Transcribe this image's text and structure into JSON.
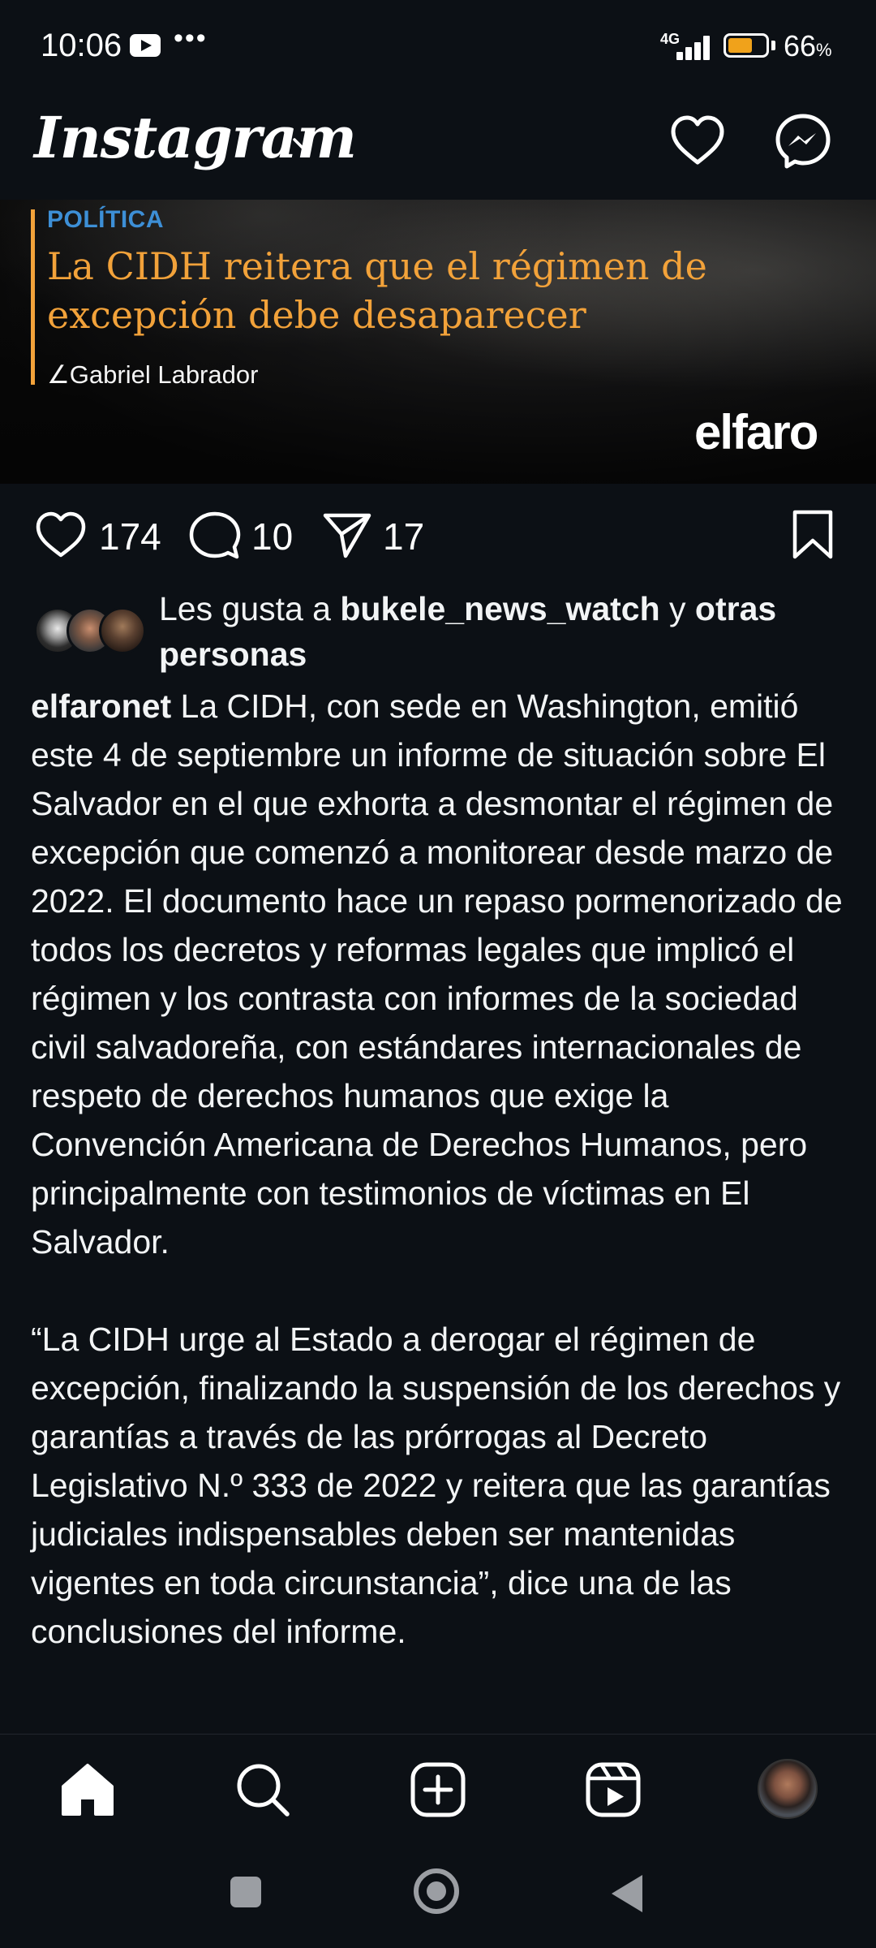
{
  "status_bar": {
    "time": "10:06",
    "overflow_dots": "•••",
    "network": "4G",
    "battery_percent": "66",
    "battery_unit": "%",
    "battery_level": 0.66
  },
  "header": {
    "logo": "Instagram"
  },
  "post_image": {
    "category": "POLÍTICA",
    "headline": "La CIDH reitera que el régimen de excepción debe desaparecer",
    "author": "∠Gabriel Labrador",
    "brand": "elfaro"
  },
  "actions": {
    "likes": "174",
    "comments": "10",
    "shares": "17"
  },
  "likes_summary": {
    "prefix": "Les gusta a ",
    "user": "bukele_news_watch",
    "connector": " y ",
    "others": "otras personas"
  },
  "caption": {
    "username": "elfaronet",
    "paragraph1": " La CIDH, con sede en Washington, emitió este 4 de septiembre un informe de situación sobre El Salvador en el que exhorta a desmontar el régimen de excepción que comenzó a monitorear desde marzo de 2022. El documento hace un repaso pormenorizado de todos los decretos y reformas legales que implicó el régimen y los contrasta con informes de la sociedad civil salvadoreña, con estándares internacionales de respeto de derechos humanos que exige la Convención Americana de Derechos Humanos, pero principalmente con testimonios de víctimas en El Salvador.",
    "paragraph2": "“La CIDH urge al Estado a derogar el régimen de excepción, finalizando la suspensión de los derechos y garantías a través de las prórrogas al Decreto Legislativo N.º 333 de 2022 y reitera que las garantías judiciales indispensables deben ser mantenidas vigentes en toda circunstancia”, dice una de las conclusiones del informe."
  },
  "colors": {
    "background": "#0c1015",
    "headline_orange": "#f2a23a",
    "category_blue": "#3d8fd6",
    "battery_fill": "#f0a21b"
  },
  "icons": [
    "youtube-icon",
    "signal-icon",
    "battery-icon",
    "chevron-down-icon",
    "heart-icon",
    "messenger-icon",
    "comment-icon",
    "share-icon",
    "bookmark-icon",
    "home-icon",
    "search-icon",
    "add-post-icon",
    "reels-icon"
  ]
}
